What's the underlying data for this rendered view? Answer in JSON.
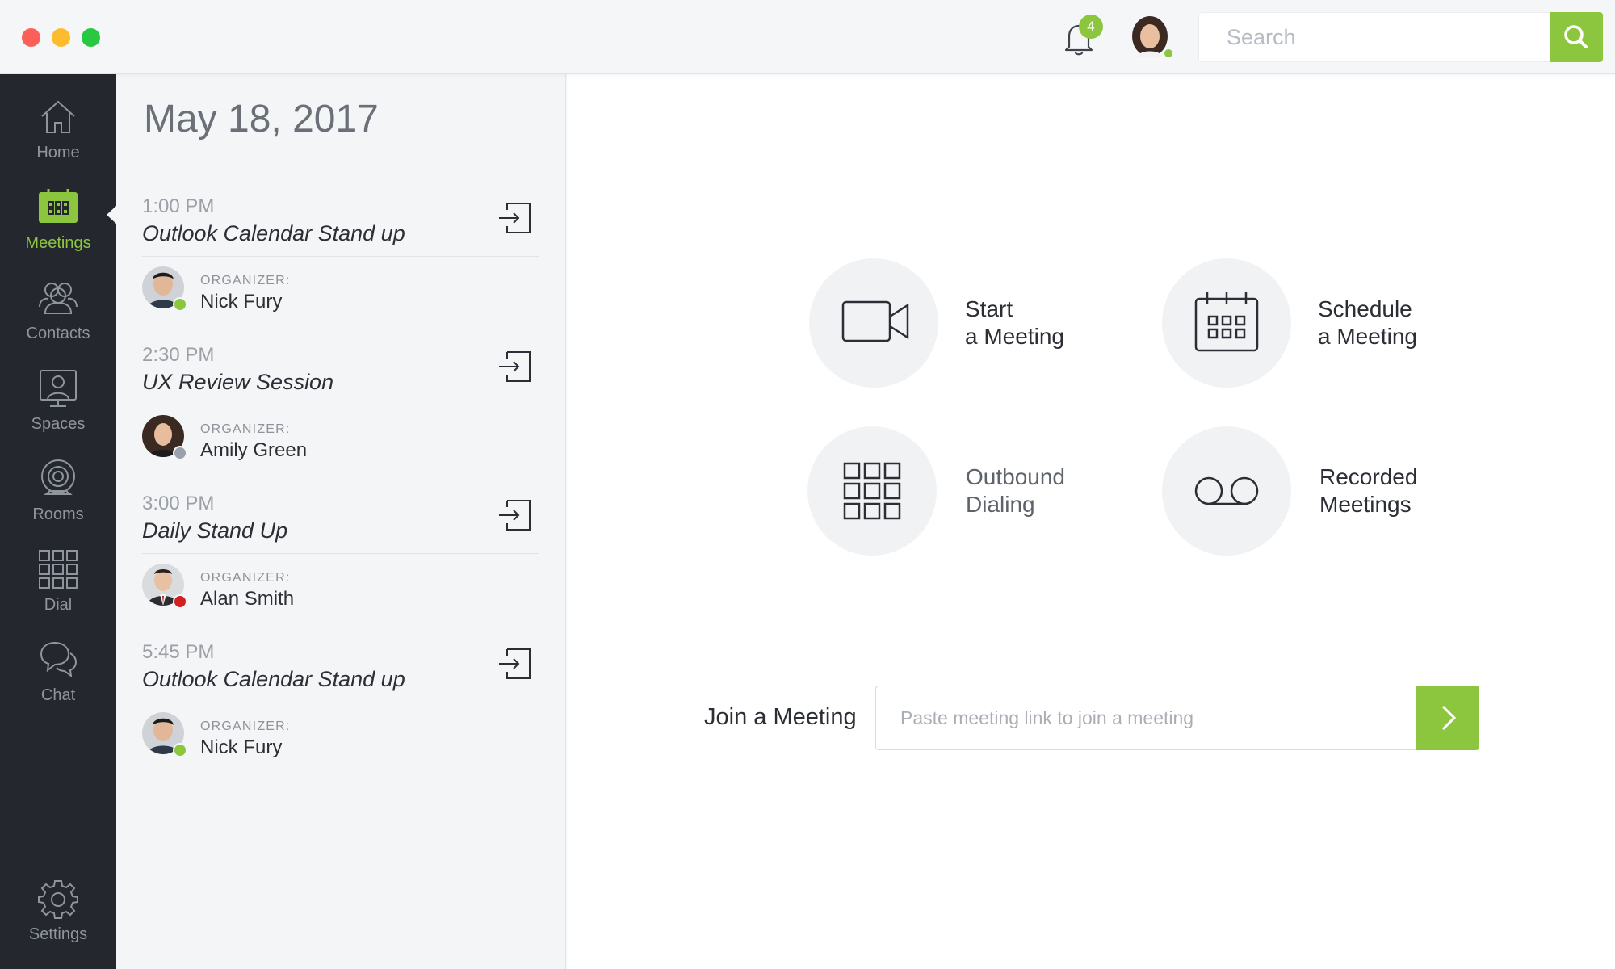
{
  "topbar": {
    "notification_count": "4",
    "search_placeholder": "Search"
  },
  "sidebar": {
    "items": [
      {
        "label": "Home",
        "icon": "home-icon"
      },
      {
        "label": "Meetings",
        "icon": "calendar-icon",
        "active": true
      },
      {
        "label": "Contacts",
        "icon": "contacts-icon"
      },
      {
        "label": "Spaces",
        "icon": "spaces-icon"
      },
      {
        "label": "Rooms",
        "icon": "webcam-icon"
      },
      {
        "label": "Dial",
        "icon": "dialpad-icon"
      },
      {
        "label": "Chat",
        "icon": "chat-bubbles-icon"
      }
    ],
    "settings_label": "Settings"
  },
  "meetings": {
    "date": "May 18, 2017",
    "organizer_label": "ORGANIZER:",
    "items": [
      {
        "time": "1:00 PM",
        "title": "Outlook Calendar Stand up",
        "organizer": "Nick Fury",
        "status_color": "#8cc63f"
      },
      {
        "time": "2:30 PM",
        "title": "UX Review Session",
        "organizer": "Amily Green",
        "status_color": "#9aa1ad"
      },
      {
        "time": "3:00 PM",
        "title": "Daily Stand Up",
        "organizer": "Alan Smith",
        "status_color": "#d21f1f"
      },
      {
        "time": "5:45 PM",
        "title": "Outlook Calendar Stand up",
        "organizer": "Nick Fury",
        "status_color": "#8cc63f"
      }
    ]
  },
  "actions": {
    "start": {
      "line1": "Start",
      "line2": "a Meeting"
    },
    "schedule": {
      "line1": "Schedule",
      "line2": "a Meeting"
    },
    "dial": {
      "line1": "Outbound",
      "line2": "Dialing"
    },
    "recorded": {
      "line1": "Recorded",
      "line2": "Meetings"
    }
  },
  "join": {
    "label": "Join a Meeting",
    "placeholder": "Paste meeting link to join a meeting"
  },
  "colors": {
    "accent": "#8cc63f",
    "sidebar_bg": "#24272d"
  }
}
